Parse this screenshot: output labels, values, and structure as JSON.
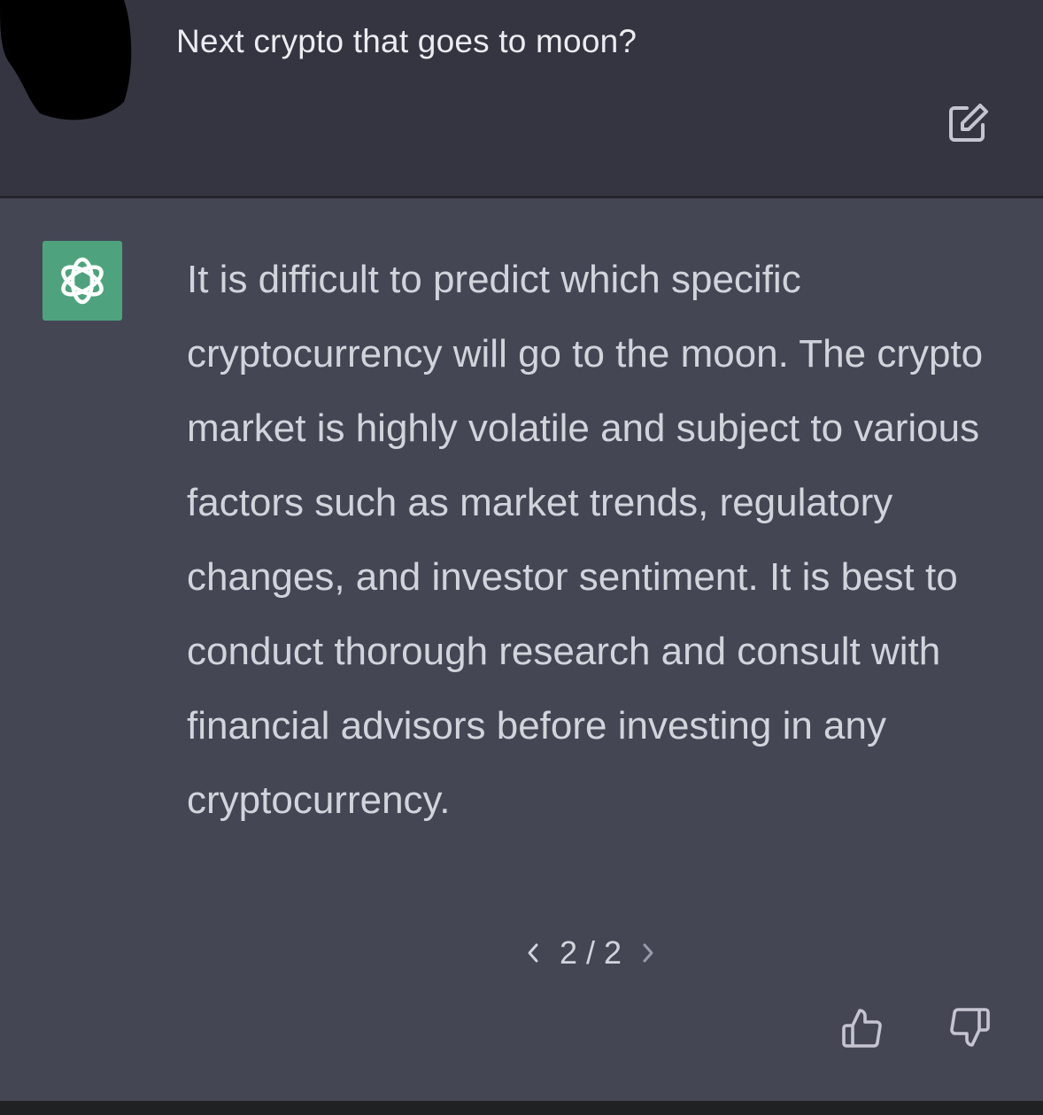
{
  "conversation": {
    "user_message": "Next crypto that goes to moon?",
    "assistant_message": "It is difficult to predict which specific cryptocurrency will go to the moon. The crypto market is highly volatile and subject to various factors such as market trends, regulatory changes, and investor sentiment. It is best to conduct thorough research and consult with financial advisors before investing in any cryptocurrency.",
    "pager": {
      "current": "2",
      "separator": "/",
      "total": "2"
    }
  },
  "icons": {
    "edit": "edit-icon",
    "logo": "openai-logo-icon",
    "prev": "chevron-left-icon",
    "next": "chevron-right-icon",
    "like": "thumbs-up-icon",
    "dislike": "thumbs-down-icon"
  },
  "colors": {
    "user_bg": "#343541",
    "assistant_bg": "#444654",
    "logo_bg": "#4ea37e",
    "text": "#d1d5db"
  }
}
